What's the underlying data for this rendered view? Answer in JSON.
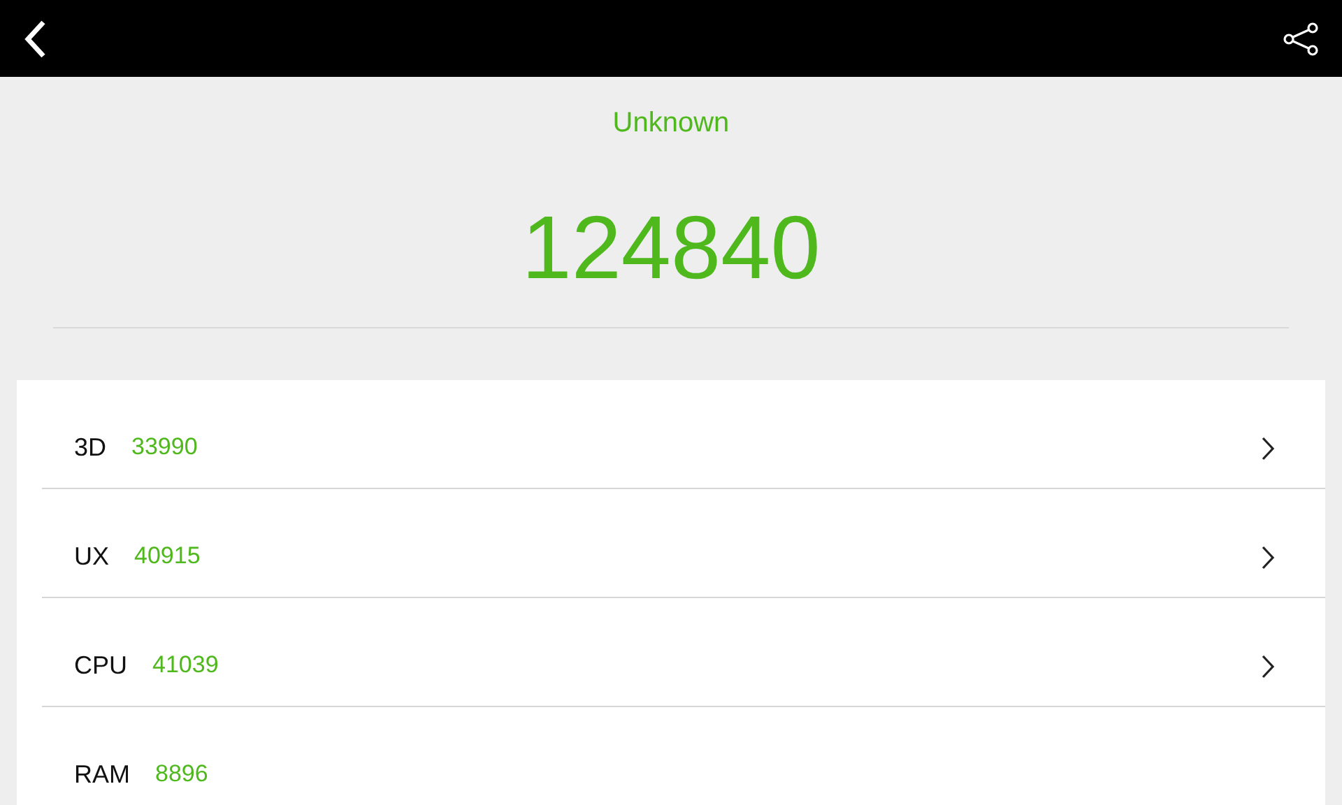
{
  "device": "Unknown",
  "total_score": "124840",
  "results": [
    {
      "label": "3D",
      "score": "33990",
      "has_details": true
    },
    {
      "label": "UX",
      "score": "40915",
      "has_details": true
    },
    {
      "label": "CPU",
      "score": "41039",
      "has_details": true
    },
    {
      "label": "RAM",
      "score": "8896",
      "has_details": false
    }
  ]
}
